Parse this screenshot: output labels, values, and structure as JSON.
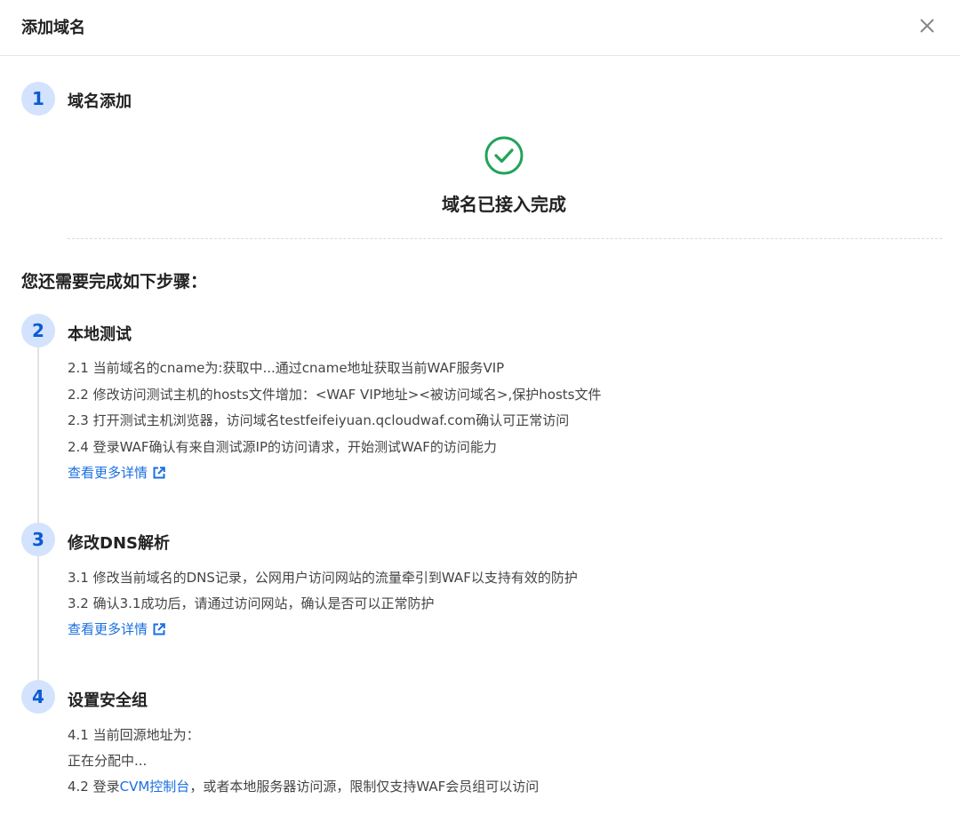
{
  "dialog": {
    "title": "添加域名",
    "close_icon": "close-icon"
  },
  "step1": {
    "number": "1",
    "title": "域名添加",
    "success_icon": "check-circle-icon",
    "success_text": "域名已接入完成"
  },
  "remaining_heading": "您还需要完成如下步骤：",
  "step2": {
    "number": "2",
    "title": "本地测试",
    "items": [
      "2.1 当前域名的cname为:获取中...通过cname地址获取当前WAF服务VIP",
      "2.2 修改访问测试主机的hosts文件增加：<WAF VIP地址><被访问域名>,保护hosts文件",
      "2.3 打开测试主机浏览器，访问域名testfeifeiyuan.qcloudwaf.com确认可正常访问",
      "2.4 登录WAF确认有来自测试源IP的访问请求，开始测试WAF的访问能力"
    ],
    "link": "查看更多详情"
  },
  "step3": {
    "number": "3",
    "title": "修改DNS解析",
    "items": [
      "3.1 修改当前域名的DNS记录，公网用户访问网站的流量牵引到WAF以支持有效的防护",
      "3.2 确认3.1成功后，请通过访问网站，确认是否可以正常防护"
    ],
    "link": "查看更多详情"
  },
  "step4": {
    "number": "4",
    "title": "设置安全组",
    "item1": "4.1 当前回源地址为：",
    "item1_value": "正在分配中...",
    "item2_prefix": "4.2 登录",
    "item2_link": "CVM控制台",
    "item2_suffix": "，或者本地服务器访问源，限制仅支持WAF会员组可以访问"
  },
  "colors": {
    "accent": "#1a6fe0",
    "step_circle_bg": "#d3e3fd",
    "success": "#21a35a"
  }
}
